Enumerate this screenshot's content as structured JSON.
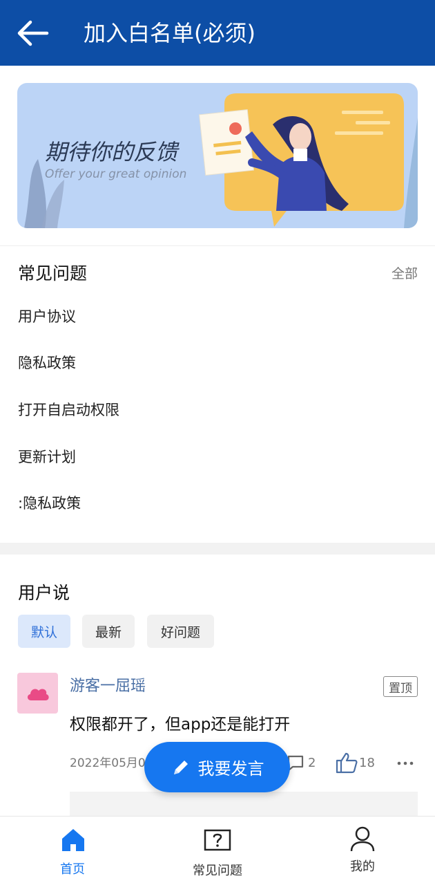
{
  "header": {
    "title": "加入白名单(必须)"
  },
  "banner": {
    "title": "期待你的反馈",
    "subtitle": "Offer your great opinion"
  },
  "faq": {
    "heading": "常见问题",
    "all_label": "全部",
    "items": [
      "用户协议",
      "隐私政策",
      "打开自启动权限",
      "更新计划",
      ":隐私政策"
    ]
  },
  "user_says": {
    "heading": "用户说",
    "tabs": [
      "默认",
      "最新",
      "好问题"
    ],
    "active_tab": "默认"
  },
  "post": {
    "author": "游客一屈瑶",
    "pin_label": "置顶",
    "content": "权限都开了，但app还是能打开",
    "date": "2022年05月0",
    "comment_count": "2",
    "like_count": "18"
  },
  "fab": {
    "label": "我要发言"
  },
  "bottom_nav": [
    {
      "label": "首页",
      "icon": "home-icon",
      "active": true
    },
    {
      "label": "常见问题",
      "icon": "question-icon",
      "active": false
    },
    {
      "label": "我的",
      "icon": "user-icon",
      "active": false
    }
  ],
  "colors": {
    "header": "#0d4ea6",
    "accent": "#1677f0",
    "banner_bg": "#bcd4f6"
  }
}
